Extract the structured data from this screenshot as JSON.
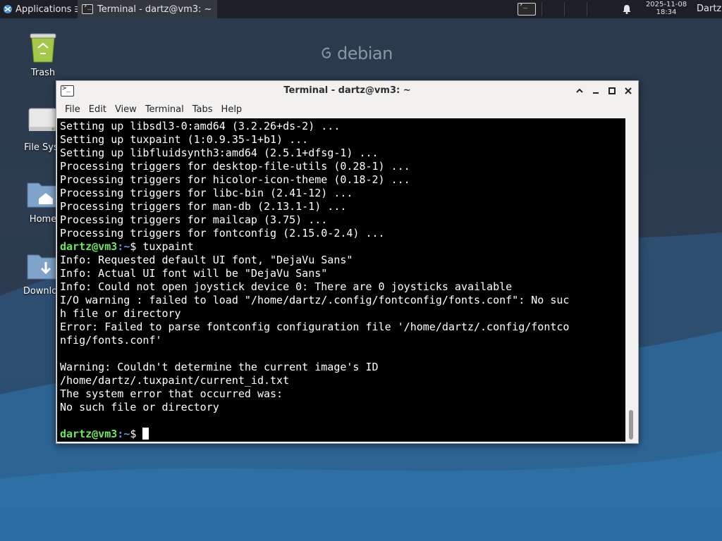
{
  "panel": {
    "applications_label": "Applications",
    "taskbar_item_label": "Terminal - dartz@vm3: ~",
    "clock_date": "2025-11-08",
    "clock_time": "18:34",
    "user_label": "Dartz"
  },
  "desktop": {
    "brand": "debian",
    "icons": [
      {
        "label": "Trash"
      },
      {
        "label": "File Syst"
      },
      {
        "label": "Home"
      },
      {
        "label": "Downloa"
      }
    ]
  },
  "window": {
    "title": "Terminal - dartz@vm3: ~",
    "menu": [
      "File",
      "Edit",
      "View",
      "Terminal",
      "Tabs",
      "Help"
    ]
  },
  "terminal": {
    "prompt_user": "dartz@vm3",
    "prompt_path": ":~",
    "prompt_symbol": "$ ",
    "command": "tuxpaint",
    "output_before": [
      "Setting up libsdl3-0:amd64 (3.2.26+ds-2) ...",
      "Setting up tuxpaint (1:0.9.35-1+b1) ...",
      "Setting up libfluidsynth3:amd64 (2.5.1+dfsg-1) ...",
      "Processing triggers for desktop-file-utils (0.28-1) ...",
      "Processing triggers for hicolor-icon-theme (0.18-2) ...",
      "Processing triggers for libc-bin (2.41-12) ...",
      "Processing triggers for man-db (2.13.1-1) ...",
      "Processing triggers for mailcap (3.75) ...",
      "Processing triggers for fontconfig (2.15.0-2.4) ..."
    ],
    "output_after": [
      "Info: Requested default UI font, \"DejaVu Sans\"",
      "Info: Actual UI font will be \"DejaVu Sans\"",
      "Info: Could not open joystick device 0: There are 0 joysticks available",
      "I/O warning : failed to load \"/home/dartz/.config/fontconfig/fonts.conf\": No suc",
      "h file or directory",
      "Error: Failed to parse fontconfig configuration file '/home/dartz/.config/fontco",
      "nfig/fonts.conf'",
      "",
      "Warning: Couldn't determine the current image's ID",
      "/home/dartz/.tuxpaint/current_id.txt",
      "The system error that occurred was:",
      "No such file or directory",
      ""
    ]
  },
  "colors": {
    "panel_bg": "#1c2026",
    "terminal_bg": "#000000",
    "prompt_user": "#6ee65c",
    "prompt_path": "#6a8fe6"
  }
}
